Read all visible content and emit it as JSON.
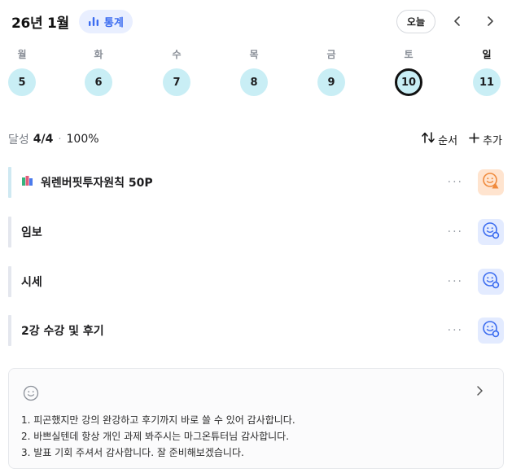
{
  "header": {
    "month_title": "26년 1월",
    "stats_label": "통계",
    "today_label": "오늘",
    "prev_icon": "chevron-left-icon",
    "next_icon": "chevron-right-icon"
  },
  "week": {
    "days": [
      {
        "name": "월",
        "date": "5"
      },
      {
        "name": "화",
        "date": "6"
      },
      {
        "name": "수",
        "date": "7"
      },
      {
        "name": "목",
        "date": "8"
      },
      {
        "name": "금",
        "date": "9"
      },
      {
        "name": "토",
        "date": "10",
        "selected": true
      },
      {
        "name": "일",
        "date": "11"
      }
    ]
  },
  "summary": {
    "label": "달성",
    "count": "4/4",
    "separator": "·",
    "percent": "100%",
    "sort_label": "순서",
    "add_label": "추가"
  },
  "tasks": [
    {
      "title": "워렌버핏투자원칙 50P",
      "icon": "books-icon",
      "status": "orange",
      "menu": "···"
    },
    {
      "title": "임보",
      "status": "blue",
      "menu": "···"
    },
    {
      "title": "시세",
      "status": "blue",
      "menu": "···"
    },
    {
      "title": "2강 수강 및 후기",
      "status": "blue",
      "menu": "···"
    }
  ],
  "memo": {
    "icon": "smile-icon",
    "lines": [
      "1. 피곤했지만 강의 완강하고 후기까지 바로 쓸 수 있어 감사합니다.",
      "2. 바쁘실텐데 항상 개인 과제 봐주시는 마그온튜터님 감사합니다.",
      "3. 발표 기회 주셔서 감사합니다. 잘 준비해보겠습니다."
    ]
  },
  "colors": {
    "accent": "#3b6cf0",
    "day_circle": "#c9eef5",
    "status_orange": "#ffe4cf",
    "status_blue": "#e3ebff"
  }
}
